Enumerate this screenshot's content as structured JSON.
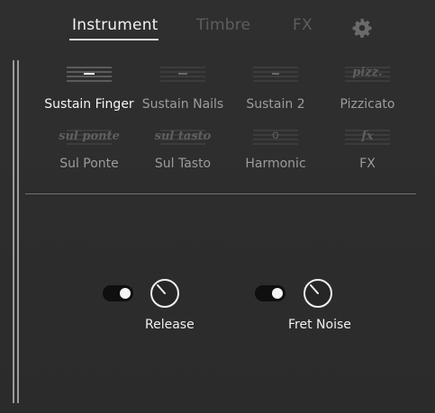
{
  "tabs": [
    {
      "label": "Instrument",
      "active": true
    },
    {
      "label": "Timbre",
      "active": false
    },
    {
      "label": "FX",
      "active": false
    }
  ],
  "settings_icon": "gear-icon",
  "articulations": [
    {
      "label": "Sustain Finger",
      "symbol": "staff-with-wide-dash",
      "active": true
    },
    {
      "label": "Sustain Nails",
      "symbol": "staff-with-dash",
      "active": false
    },
    {
      "label": "Sustain 2",
      "symbol": "staff-with-short-dash",
      "active": false
    },
    {
      "label": "Pizzicato",
      "notation": "pizz.",
      "active": false
    },
    {
      "label": "Sul Ponte",
      "notation": "sul ponte",
      "active": false
    },
    {
      "label": "Sul Tasto",
      "notation": "sul tasto",
      "active": false
    },
    {
      "label": "Harmonic",
      "notation": "o",
      "active": false
    },
    {
      "label": "FX",
      "notation": "fx",
      "active": false
    }
  ],
  "controls": [
    {
      "label": "Release",
      "toggle_on": true,
      "knob_icon": "knob-icon"
    },
    {
      "label": "Fret Noise",
      "toggle_on": true,
      "knob_icon": "knob-icon"
    }
  ],
  "colors": {
    "background": "#2d2d2d",
    "active_text": "#f2f2f2",
    "inactive_text": "#9c9c9c"
  }
}
